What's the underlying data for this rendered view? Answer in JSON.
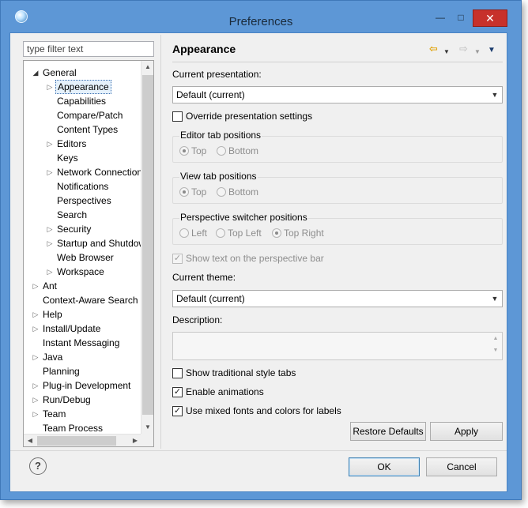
{
  "window": {
    "title": "Preferences",
    "minimize": "—",
    "maximize": "□",
    "close": "✕"
  },
  "filter": {
    "placeholder": "type filter text"
  },
  "tree": [
    {
      "label": "General",
      "level": 0,
      "arrow": "open"
    },
    {
      "label": "Appearance",
      "level": 1,
      "arrow": "closed",
      "selected": true
    },
    {
      "label": "Capabilities",
      "level": 1,
      "arrow": ""
    },
    {
      "label": "Compare/Patch",
      "level": 1,
      "arrow": ""
    },
    {
      "label": "Content Types",
      "level": 1,
      "arrow": ""
    },
    {
      "label": "Editors",
      "level": 1,
      "arrow": "closed"
    },
    {
      "label": "Keys",
      "level": 1,
      "arrow": ""
    },
    {
      "label": "Network Connection",
      "level": 1,
      "arrow": "closed"
    },
    {
      "label": "Notifications",
      "level": 1,
      "arrow": ""
    },
    {
      "label": "Perspectives",
      "level": 1,
      "arrow": ""
    },
    {
      "label": "Search",
      "level": 1,
      "arrow": ""
    },
    {
      "label": "Security",
      "level": 1,
      "arrow": "closed"
    },
    {
      "label": "Startup and Shutdown",
      "level": 1,
      "arrow": "closed"
    },
    {
      "label": "Web Browser",
      "level": 1,
      "arrow": ""
    },
    {
      "label": "Workspace",
      "level": 1,
      "arrow": "closed"
    },
    {
      "label": "Ant",
      "level": 0,
      "arrow": "closed"
    },
    {
      "label": "Context-Aware Search",
      "level": 0,
      "arrow": ""
    },
    {
      "label": "Help",
      "level": 0,
      "arrow": "closed"
    },
    {
      "label": "Install/Update",
      "level": 0,
      "arrow": "closed"
    },
    {
      "label": "Instant Messaging",
      "level": 0,
      "arrow": ""
    },
    {
      "label": "Java",
      "level": 0,
      "arrow": "closed"
    },
    {
      "label": "Planning",
      "level": 0,
      "arrow": ""
    },
    {
      "label": "Plug-in Development",
      "level": 0,
      "arrow": "closed"
    },
    {
      "label": "Run/Debug",
      "level": 0,
      "arrow": "closed"
    },
    {
      "label": "Team",
      "level": 0,
      "arrow": "closed"
    },
    {
      "label": "Team Process",
      "level": 0,
      "arrow": ""
    }
  ],
  "page": {
    "title": "Appearance",
    "nav": {
      "back": "⇦",
      "forward": "⇨",
      "dropdown": "▼",
      "menu": "▼"
    },
    "current_presentation_label": "Current presentation:",
    "current_presentation_value": "Default (current)",
    "override_label": "Override presentation settings",
    "override_checked": false,
    "editor_tab": {
      "title": "Editor tab positions",
      "top": "Top",
      "bottom": "Bottom",
      "selected": "Top"
    },
    "view_tab": {
      "title": "View tab positions",
      "top": "Top",
      "bottom": "Bottom",
      "selected": "Top"
    },
    "perspective_switcher": {
      "title": "Perspective switcher positions",
      "left": "Left",
      "top_left": "Top Left",
      "top_right": "Top Right",
      "selected": "Top Right"
    },
    "show_text_label": "Show text on the perspective bar",
    "show_text_checked": true,
    "current_theme_label": "Current theme:",
    "current_theme_value": "Default (current)",
    "description_label": "Description:",
    "description_value": "",
    "traditional_tabs_label": "Show traditional style tabs",
    "traditional_tabs_checked": false,
    "enable_animations_label": "Enable animations",
    "enable_animations_checked": true,
    "mixed_fonts_label": "Use mixed fonts and colors for labels",
    "mixed_fonts_checked": true,
    "restore_defaults": "Restore Defaults",
    "apply": "Apply"
  },
  "footer": {
    "help": "?",
    "ok": "OK",
    "cancel": "Cancel"
  },
  "colors": {
    "title_bar": "#5d97d6",
    "close_button": "#c7312b",
    "client_bg": "#f0f0f0",
    "selection": "#e5f1fb"
  }
}
